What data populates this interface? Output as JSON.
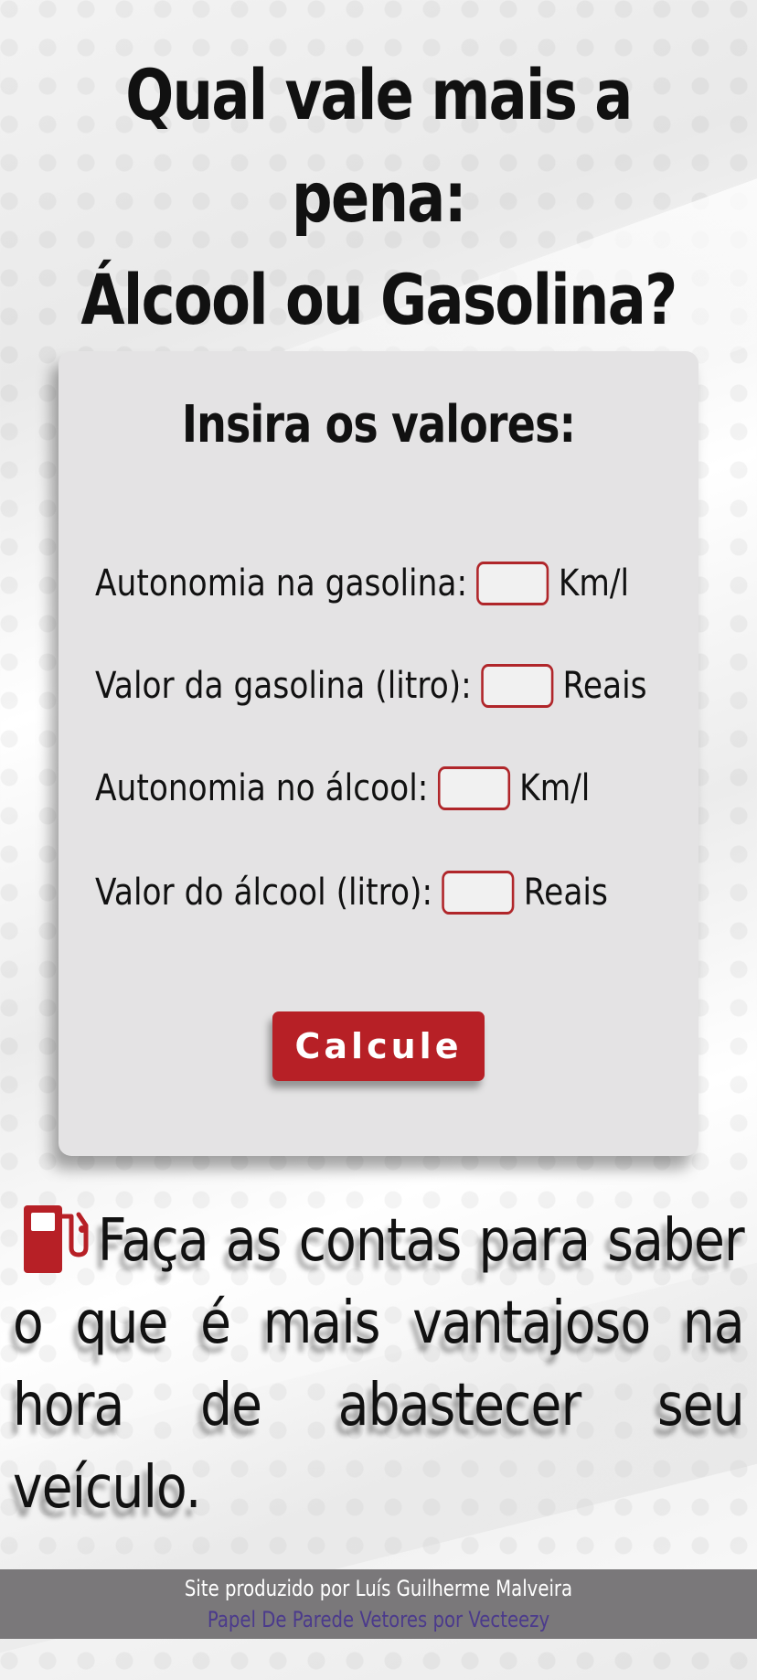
{
  "header": {
    "title_line1": "Qual vale mais a pena:",
    "title_line2": "Álcool ou Gasolina?"
  },
  "form": {
    "heading": "Insira os valores:",
    "fields": [
      {
        "label": "Autonomia na gasolina:",
        "unit": "Km/l",
        "value": ""
      },
      {
        "label": "Valor da gasolina (litro):",
        "unit": "Reais",
        "value": ""
      },
      {
        "label": "Autonomia no álcool:",
        "unit": "Km/l",
        "value": ""
      },
      {
        "label": "Valor do álcool (litro):",
        "unit": "Reais",
        "value": ""
      }
    ],
    "button_label": "Calcule"
  },
  "tip": {
    "icon": "fuel-pump-icon",
    "text": "Faça as contas para saber o que é mais vantajoso na hora de abastecer seu veículo."
  },
  "footer": {
    "credit": "Site produzido por Luís Guilherme Malveira",
    "wallpaper_link": "Papel De Parede Vetores por Vecteezy"
  },
  "colors": {
    "accent": "#b72026",
    "card_background": "#e4e3e4",
    "footer_background": "#7a787a",
    "link": "#4b3a8c"
  }
}
